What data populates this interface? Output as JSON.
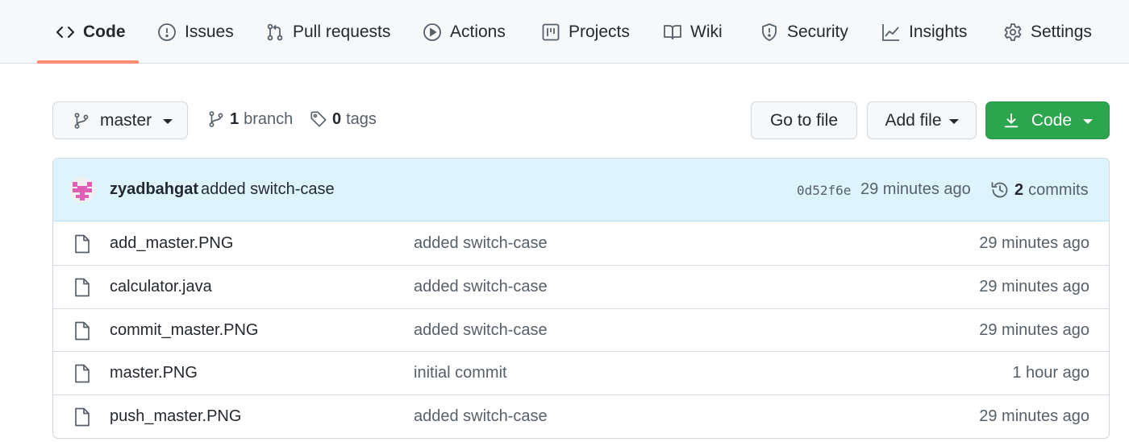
{
  "nav": {
    "tabs": [
      {
        "label": "Code",
        "icon": "code-icon",
        "selected": true
      },
      {
        "label": "Issues",
        "icon": "issue-opened-icon"
      },
      {
        "label": "Pull requests",
        "icon": "git-pull-request-icon"
      },
      {
        "label": "Actions",
        "icon": "play-icon"
      },
      {
        "label": "Projects",
        "icon": "project-icon"
      },
      {
        "label": "Wiki",
        "icon": "book-icon"
      },
      {
        "label": "Security",
        "icon": "shield-icon"
      },
      {
        "label": "Insights",
        "icon": "graph-icon"
      },
      {
        "label": "Settings",
        "icon": "gear-icon"
      }
    ],
    "accent_color": "#fd8c73"
  },
  "toolbar": {
    "branch_selector": "master",
    "branch_count": "1",
    "branch_label": "branch",
    "tag_count": "0",
    "tag_label": "tags",
    "go_to_file": "Go to file",
    "add_file": "Add file",
    "code_button": "Code",
    "code_button_color": "#2da44e"
  },
  "latest_commit": {
    "author": "zyadbahgat",
    "message": "added switch-case",
    "sha": "0d52f6e",
    "time": "29 minutes ago",
    "commit_count": "2",
    "commit_label": "commits"
  },
  "files": [
    {
      "name": "add_master.PNG",
      "message": "added switch-case",
      "time": "29 minutes ago"
    },
    {
      "name": "calculator.java",
      "message": "added switch-case",
      "time": "29 minutes ago"
    },
    {
      "name": "commit_master.PNG",
      "message": "added switch-case",
      "time": "29 minutes ago"
    },
    {
      "name": "master.PNG",
      "message": "initial commit",
      "time": "1 hour ago"
    },
    {
      "name": "push_master.PNG",
      "message": "added switch-case",
      "time": "29 minutes ago"
    }
  ]
}
